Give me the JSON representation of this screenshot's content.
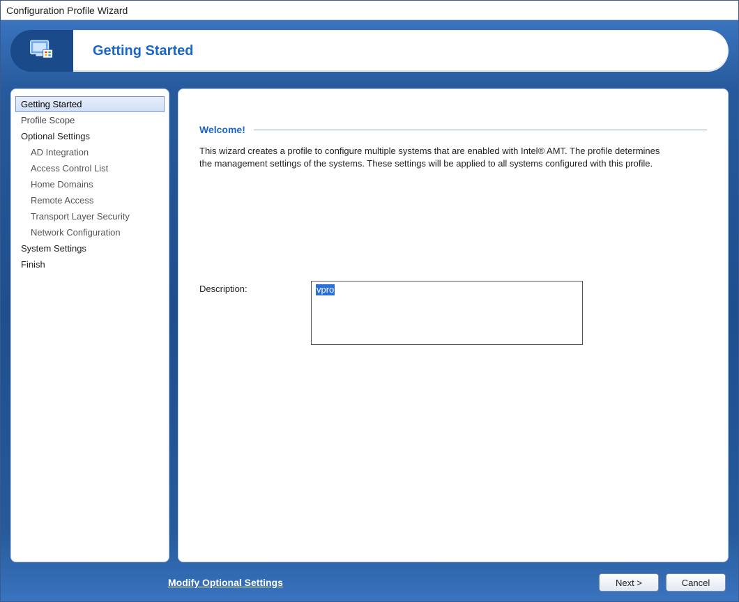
{
  "window": {
    "title": "Configuration Profile Wizard"
  },
  "banner": {
    "title": "Getting Started"
  },
  "nav": {
    "items": [
      {
        "label": "Getting Started",
        "type": "top",
        "selected": true
      },
      {
        "label": "Profile Scope",
        "type": "top"
      },
      {
        "label": "Optional Settings",
        "type": "heading"
      },
      {
        "label": "AD Integration",
        "type": "sub"
      },
      {
        "label": "Access Control List",
        "type": "sub"
      },
      {
        "label": "Home Domains",
        "type": "sub"
      },
      {
        "label": "Remote Access",
        "type": "sub"
      },
      {
        "label": "Transport Layer Security",
        "type": "sub"
      },
      {
        "label": "Network Configuration",
        "type": "sub"
      },
      {
        "label": "System Settings",
        "type": "top"
      },
      {
        "label": "Finish",
        "type": "top"
      }
    ]
  },
  "main": {
    "section_title": "Welcome!",
    "body_text": "This wizard creates a profile to configure multiple systems that are enabled with Intel® AMT. The profile determines the management settings of the systems. These settings will be applied to all systems configured with this profile.",
    "description_label": "Description:",
    "description_value": "vpro"
  },
  "footer": {
    "link_label": "Modify Optional Settings",
    "next_label": "Next >",
    "cancel_label": "Cancel"
  }
}
